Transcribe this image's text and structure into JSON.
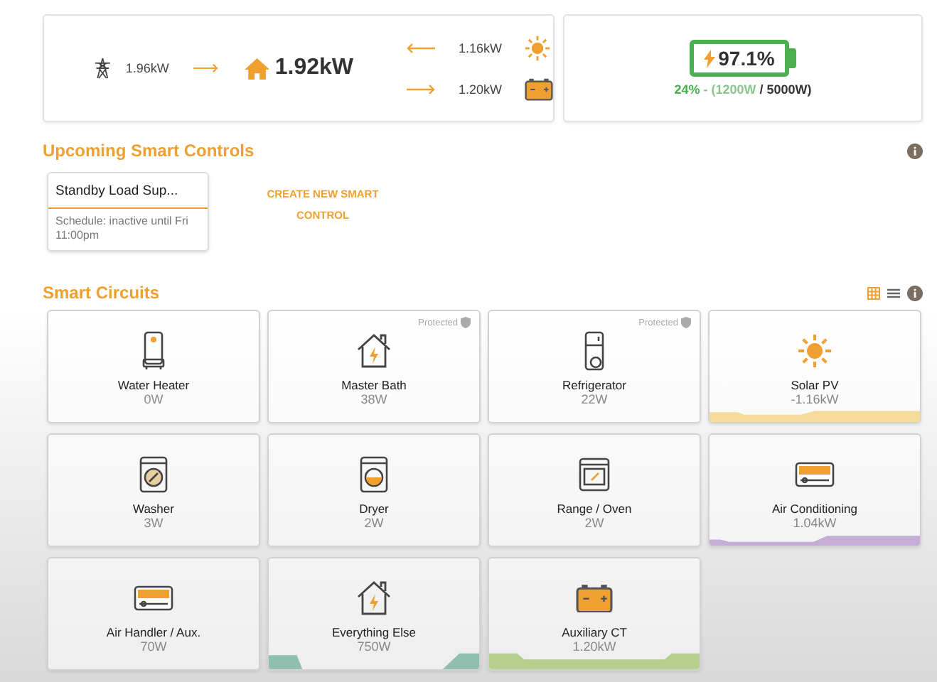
{
  "energy_flow": {
    "grid": "1.96kW",
    "home": "1.92kW",
    "solar": "1.16kW",
    "battery": "1.20kW"
  },
  "battery": {
    "charge": "97.1%",
    "power_parts": [
      {
        "kind": "percent",
        "text": "24%"
      },
      {
        "kind": "current",
        "text": " - (1200W"
      },
      {
        "kind": "max",
        "text": " / 5000W)"
      }
    ]
  },
  "smart_controls": {
    "title": "Upcoming Smart Controls",
    "items": [
      {
        "name": "Standby Load Sup...",
        "schedule": "Schedule: inactive until Fri 11:00pm"
      }
    ],
    "create_label": "CREATE NEW SMART CONTROL"
  },
  "smart_circuits": {
    "title": "Smart Circuits",
    "views": [
      {
        "kind": "grid",
        "selected": true
      },
      {
        "kind": "list",
        "selected": false
      }
    ],
    "items": [
      {
        "kind": "water-heater",
        "name": "Water Heater",
        "power": "0W",
        "protected": false
      },
      {
        "kind": "house",
        "name": "Master Bath",
        "power": "38W",
        "protected": true,
        "protected_label": "Protected"
      },
      {
        "kind": "fridge",
        "name": "Refrigerator",
        "power": "22W",
        "protected": true,
        "protected_label": "Protected"
      },
      {
        "kind": "sun",
        "name": "Solar PV",
        "power": "-1.16kW",
        "protected": false,
        "color": "#f6dc9a"
      },
      {
        "kind": "washer",
        "name": "Washer",
        "power": "3W",
        "protected": false
      },
      {
        "kind": "dryer",
        "name": "Dryer",
        "power": "2W",
        "protected": false
      },
      {
        "kind": "oven",
        "name": "Range / Oven",
        "power": "2W",
        "protected": false
      },
      {
        "kind": "ac",
        "name": "Air Conditioning",
        "power": "1.04kW",
        "protected": false,
        "color": "#c5add6"
      },
      {
        "kind": "ac",
        "name": "Air Handler / Aux.",
        "power": "70W",
        "protected": false
      },
      {
        "kind": "house",
        "name": "Everything Else",
        "power": "750W",
        "protected": false,
        "color": "#8fbfae"
      },
      {
        "kind": "battery",
        "name": "Auxiliary CT",
        "power": "1.20kW",
        "protected": false,
        "color": "#b6cf8e"
      }
    ]
  }
}
